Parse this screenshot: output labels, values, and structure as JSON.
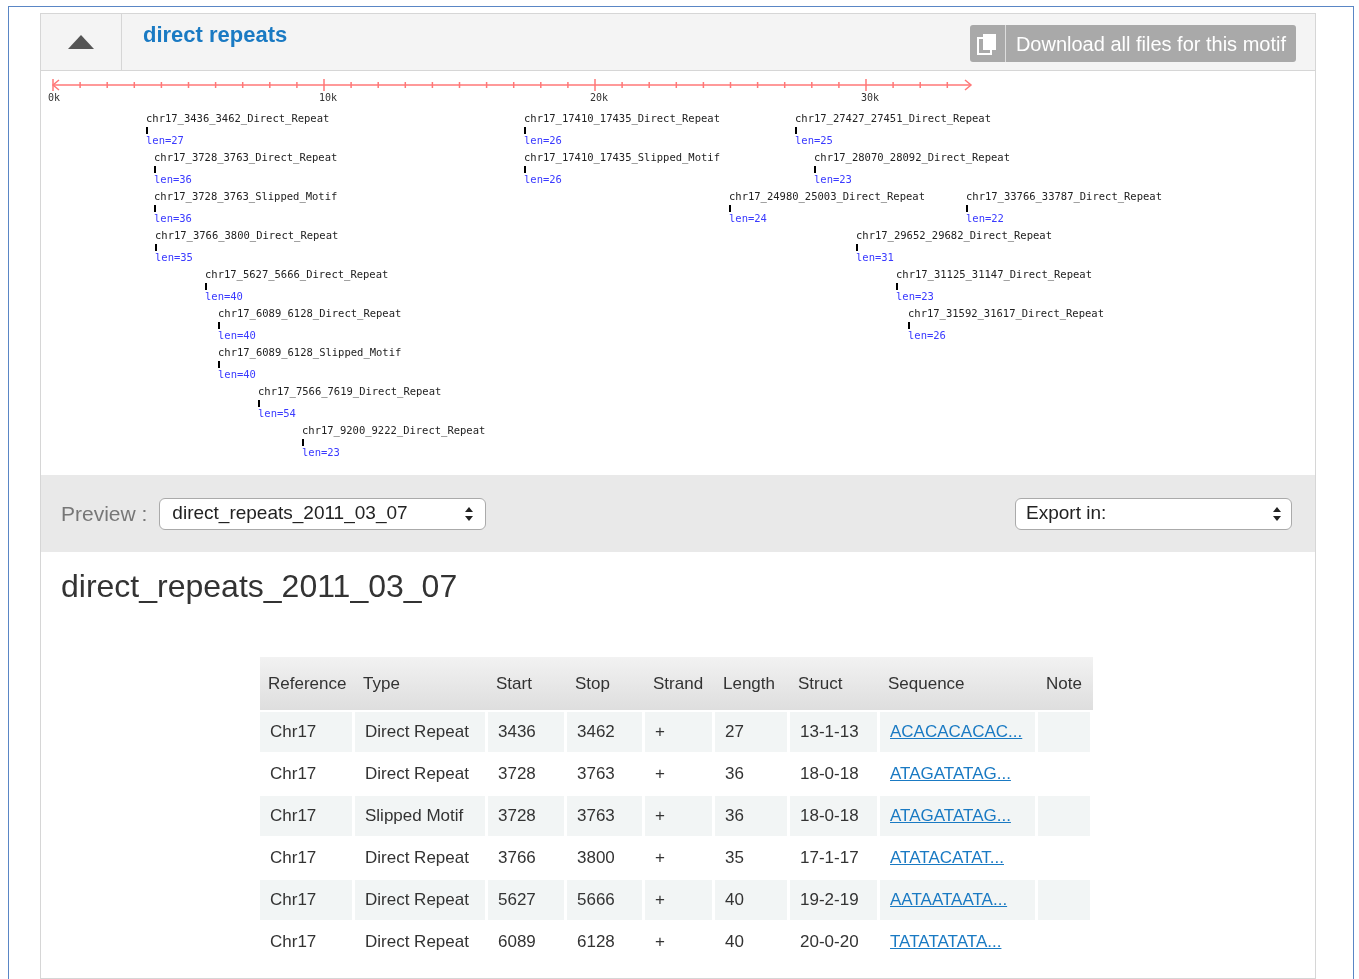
{
  "section": {
    "title": "direct repeats",
    "expanded": true,
    "download_button": "Download all files for this motif"
  },
  "track": {
    "ruler_labels": [
      "0k",
      "10k",
      "20k",
      "30k"
    ],
    "features": [
      {
        "name": "chr17_3436_3462_Direct_Repeat",
        "len": "len=27"
      },
      {
        "name": "chr17_3728_3763_Direct_Repeat",
        "len": "len=36"
      },
      {
        "name": "chr17_3728_3763_Slipped_Motif",
        "len": "len=36"
      },
      {
        "name": "chr17_3766_3800_Direct_Repeat",
        "len": "len=35"
      },
      {
        "name": "chr17_5627_5666_Direct_Repeat",
        "len": "len=40"
      },
      {
        "name": "chr17_6089_6128_Direct_Repeat",
        "len": "len=40"
      },
      {
        "name": "chr17_6089_6128_Slipped_Motif",
        "len": "len=40"
      },
      {
        "name": "chr17_7566_7619_Direct_Repeat",
        "len": "len=54"
      },
      {
        "name": "chr17_9200_9222_Direct_Repeat",
        "len": "len=23"
      },
      {
        "name": "chr17_17410_17435_Direct_Repeat",
        "len": "len=26"
      },
      {
        "name": "chr17_17410_17435_Slipped_Motif",
        "len": "len=26"
      },
      {
        "name": "chr17_27427_27451_Direct_Repeat",
        "len": "len=25"
      },
      {
        "name": "chr17_28070_28092_Direct_Repeat",
        "len": "len=23"
      },
      {
        "name": "chr17_24980_25003_Direct_Repeat",
        "len": "len=24"
      },
      {
        "name": "chr17_33766_33787_Direct_Repeat",
        "len": "len=22"
      },
      {
        "name": "chr17_29652_29682_Direct_Repeat",
        "len": "len=31"
      },
      {
        "name": "chr17_31125_31147_Direct_Repeat",
        "len": "len=23"
      },
      {
        "name": "chr17_31592_31617_Direct_Repeat",
        "len": "len=26"
      }
    ]
  },
  "preview": {
    "label": "Preview :",
    "select_value": "direct_repeats_2011_03_07",
    "export_label": "Export in:"
  },
  "heading": "direct_repeats_2011_03_07",
  "table": {
    "columns": [
      "Reference",
      "Type",
      "Start",
      "Stop",
      "Strand",
      "Length",
      "Struct",
      "Sequence",
      "Note"
    ],
    "rows": [
      [
        "Chr17",
        "Direct Repeat",
        "3436",
        "3462",
        "+",
        "27",
        "13-1-13",
        "ACACACACAC..."
      ],
      [
        "Chr17",
        "Direct Repeat",
        "3728",
        "3763",
        "+",
        "36",
        "18-0-18",
        "ATAGATATAG..."
      ],
      [
        "Chr17",
        "Slipped Motif",
        "3728",
        "3763",
        "+",
        "36",
        "18-0-18",
        "ATAGATATAG..."
      ],
      [
        "Chr17",
        "Direct Repeat",
        "3766",
        "3800",
        "+",
        "35",
        "17-1-17",
        "ATATACATAT..."
      ],
      [
        "Chr17",
        "Direct Repeat",
        "5627",
        "5666",
        "+",
        "40",
        "19-2-19",
        "AATAATAATA..."
      ],
      [
        "Chr17",
        "Direct Repeat",
        "6089",
        "6128",
        "+",
        "40",
        "20-0-20",
        "TATATATATA..."
      ]
    ]
  }
}
